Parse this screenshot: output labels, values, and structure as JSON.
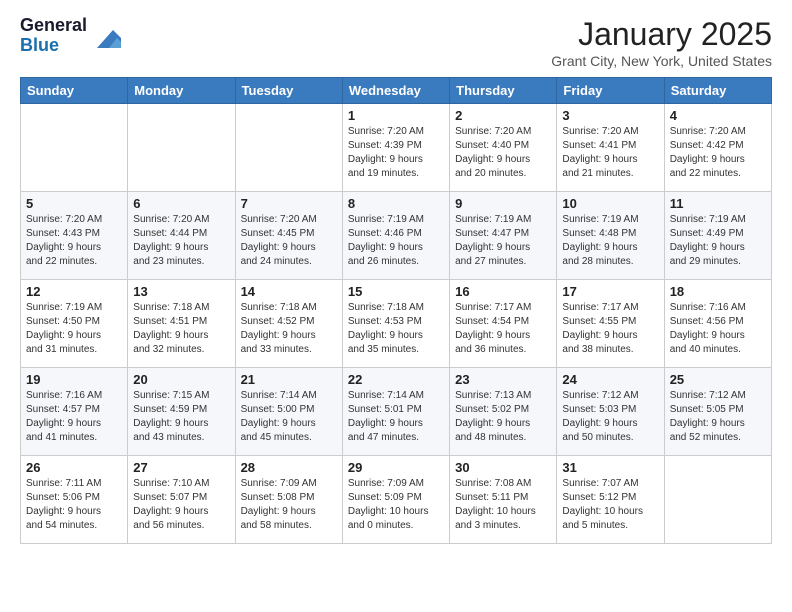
{
  "header": {
    "logo_general": "General",
    "logo_blue": "Blue",
    "month": "January 2025",
    "location": "Grant City, New York, United States"
  },
  "weekdays": [
    "Sunday",
    "Monday",
    "Tuesday",
    "Wednesday",
    "Thursday",
    "Friday",
    "Saturday"
  ],
  "weeks": [
    [
      {
        "day": "",
        "info": ""
      },
      {
        "day": "",
        "info": ""
      },
      {
        "day": "",
        "info": ""
      },
      {
        "day": "1",
        "info": "Sunrise: 7:20 AM\nSunset: 4:39 PM\nDaylight: 9 hours\nand 19 minutes."
      },
      {
        "day": "2",
        "info": "Sunrise: 7:20 AM\nSunset: 4:40 PM\nDaylight: 9 hours\nand 20 minutes."
      },
      {
        "day": "3",
        "info": "Sunrise: 7:20 AM\nSunset: 4:41 PM\nDaylight: 9 hours\nand 21 minutes."
      },
      {
        "day": "4",
        "info": "Sunrise: 7:20 AM\nSunset: 4:42 PM\nDaylight: 9 hours\nand 22 minutes."
      }
    ],
    [
      {
        "day": "5",
        "info": "Sunrise: 7:20 AM\nSunset: 4:43 PM\nDaylight: 9 hours\nand 22 minutes."
      },
      {
        "day": "6",
        "info": "Sunrise: 7:20 AM\nSunset: 4:44 PM\nDaylight: 9 hours\nand 23 minutes."
      },
      {
        "day": "7",
        "info": "Sunrise: 7:20 AM\nSunset: 4:45 PM\nDaylight: 9 hours\nand 24 minutes."
      },
      {
        "day": "8",
        "info": "Sunrise: 7:19 AM\nSunset: 4:46 PM\nDaylight: 9 hours\nand 26 minutes."
      },
      {
        "day": "9",
        "info": "Sunrise: 7:19 AM\nSunset: 4:47 PM\nDaylight: 9 hours\nand 27 minutes."
      },
      {
        "day": "10",
        "info": "Sunrise: 7:19 AM\nSunset: 4:48 PM\nDaylight: 9 hours\nand 28 minutes."
      },
      {
        "day": "11",
        "info": "Sunrise: 7:19 AM\nSunset: 4:49 PM\nDaylight: 9 hours\nand 29 minutes."
      }
    ],
    [
      {
        "day": "12",
        "info": "Sunrise: 7:19 AM\nSunset: 4:50 PM\nDaylight: 9 hours\nand 31 minutes."
      },
      {
        "day": "13",
        "info": "Sunrise: 7:18 AM\nSunset: 4:51 PM\nDaylight: 9 hours\nand 32 minutes."
      },
      {
        "day": "14",
        "info": "Sunrise: 7:18 AM\nSunset: 4:52 PM\nDaylight: 9 hours\nand 33 minutes."
      },
      {
        "day": "15",
        "info": "Sunrise: 7:18 AM\nSunset: 4:53 PM\nDaylight: 9 hours\nand 35 minutes."
      },
      {
        "day": "16",
        "info": "Sunrise: 7:17 AM\nSunset: 4:54 PM\nDaylight: 9 hours\nand 36 minutes."
      },
      {
        "day": "17",
        "info": "Sunrise: 7:17 AM\nSunset: 4:55 PM\nDaylight: 9 hours\nand 38 minutes."
      },
      {
        "day": "18",
        "info": "Sunrise: 7:16 AM\nSunset: 4:56 PM\nDaylight: 9 hours\nand 40 minutes."
      }
    ],
    [
      {
        "day": "19",
        "info": "Sunrise: 7:16 AM\nSunset: 4:57 PM\nDaylight: 9 hours\nand 41 minutes."
      },
      {
        "day": "20",
        "info": "Sunrise: 7:15 AM\nSunset: 4:59 PM\nDaylight: 9 hours\nand 43 minutes."
      },
      {
        "day": "21",
        "info": "Sunrise: 7:14 AM\nSunset: 5:00 PM\nDaylight: 9 hours\nand 45 minutes."
      },
      {
        "day": "22",
        "info": "Sunrise: 7:14 AM\nSunset: 5:01 PM\nDaylight: 9 hours\nand 47 minutes."
      },
      {
        "day": "23",
        "info": "Sunrise: 7:13 AM\nSunset: 5:02 PM\nDaylight: 9 hours\nand 48 minutes."
      },
      {
        "day": "24",
        "info": "Sunrise: 7:12 AM\nSunset: 5:03 PM\nDaylight: 9 hours\nand 50 minutes."
      },
      {
        "day": "25",
        "info": "Sunrise: 7:12 AM\nSunset: 5:05 PM\nDaylight: 9 hours\nand 52 minutes."
      }
    ],
    [
      {
        "day": "26",
        "info": "Sunrise: 7:11 AM\nSunset: 5:06 PM\nDaylight: 9 hours\nand 54 minutes."
      },
      {
        "day": "27",
        "info": "Sunrise: 7:10 AM\nSunset: 5:07 PM\nDaylight: 9 hours\nand 56 minutes."
      },
      {
        "day": "28",
        "info": "Sunrise: 7:09 AM\nSunset: 5:08 PM\nDaylight: 9 hours\nand 58 minutes."
      },
      {
        "day": "29",
        "info": "Sunrise: 7:09 AM\nSunset: 5:09 PM\nDaylight: 10 hours\nand 0 minutes."
      },
      {
        "day": "30",
        "info": "Sunrise: 7:08 AM\nSunset: 5:11 PM\nDaylight: 10 hours\nand 3 minutes."
      },
      {
        "day": "31",
        "info": "Sunrise: 7:07 AM\nSunset: 5:12 PM\nDaylight: 10 hours\nand 5 minutes."
      },
      {
        "day": "",
        "info": ""
      }
    ]
  ]
}
